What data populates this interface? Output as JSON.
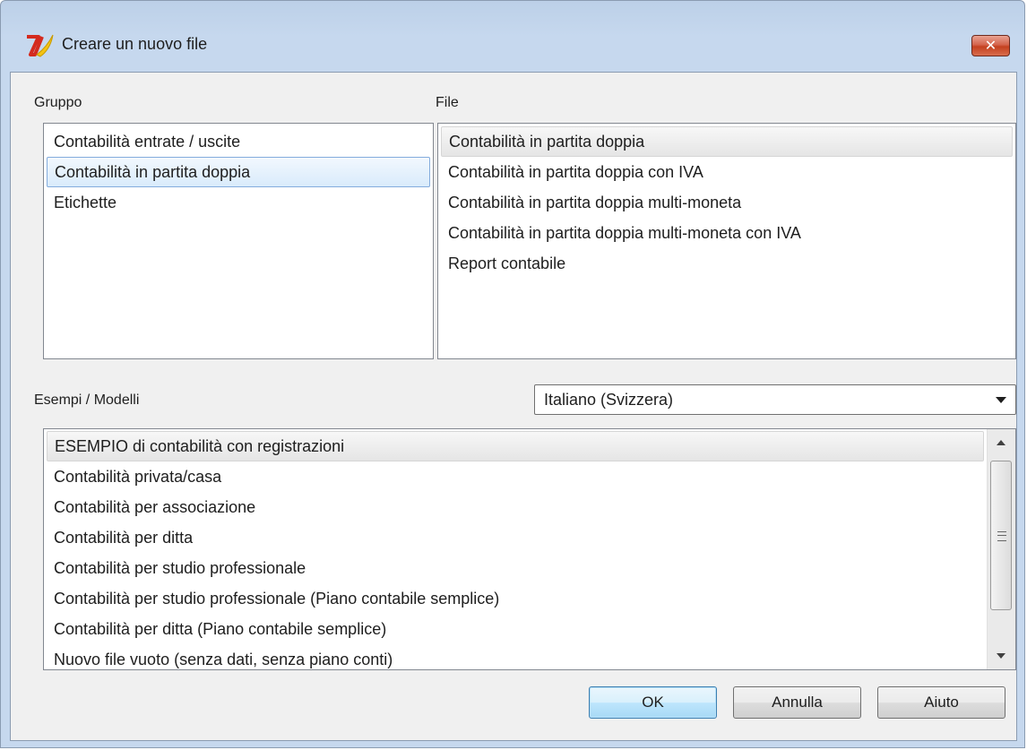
{
  "window": {
    "title": "Creare un nuovo file",
    "close_glyph": "✕",
    "app_icon": "banana-logo-icon",
    "colors": {
      "accent_blue": "#84acdd",
      "close_red": "#c4411f",
      "chrome": "#c6d8ee"
    }
  },
  "gruppo": {
    "label": "Gruppo",
    "items": [
      {
        "label": "Contabilità entrate / uscite"
      },
      {
        "label": "Contabilità in partita doppia"
      },
      {
        "label": "Etichette"
      }
    ],
    "selected": "Contabilità in partita doppia"
  },
  "file": {
    "label": "File",
    "items": [
      {
        "label": "Contabilità in partita doppia"
      },
      {
        "label": "Contabilità in partita doppia con IVA"
      },
      {
        "label": "Contabilità in partita doppia multi-moneta"
      },
      {
        "label": "Contabilità in partita doppia multi-moneta con IVA"
      },
      {
        "label": "Report contabile"
      }
    ],
    "selected": "Contabilità in partita doppia"
  },
  "esempi": {
    "label": "Esempi / Modelli",
    "language": "Italiano (Svizzera)",
    "items": [
      {
        "label": "ESEMPIO di contabilità con registrazioni"
      },
      {
        "label": "Contabilità privata/casa"
      },
      {
        "label": "Contabilità per associazione"
      },
      {
        "label": "Contabilità per ditta"
      },
      {
        "label": "Contabilità per studio professionale"
      },
      {
        "label": "Contabilità per studio professionale (Piano contabile semplice)"
      },
      {
        "label": "Contabilità per ditta (Piano contabile semplice)"
      },
      {
        "label": "Nuovo file vuoto (senza dati, senza piano conti)"
      }
    ],
    "selected": "ESEMPIO di contabilità con registrazioni"
  },
  "buttons": {
    "ok": "OK",
    "cancel": "Annulla",
    "help": "Aiuto"
  }
}
